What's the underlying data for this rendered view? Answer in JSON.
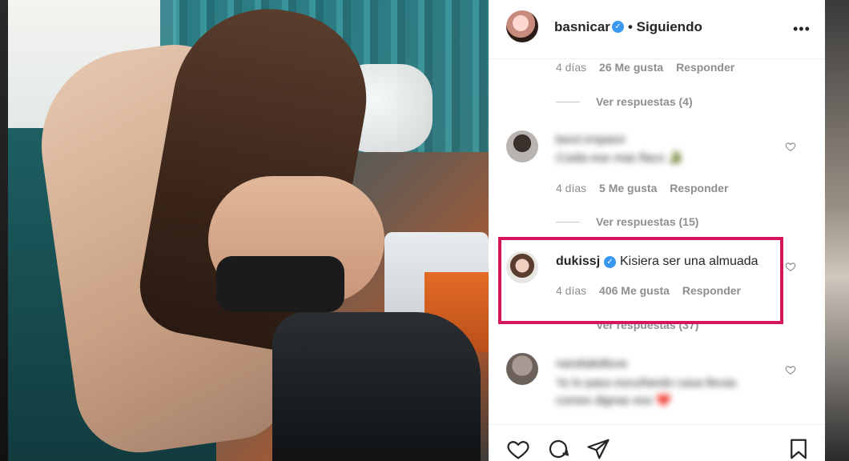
{
  "post": {
    "username": "basnicar",
    "follow_status": "• Siguiendo",
    "more_label": "•••"
  },
  "comments": [
    {
      "time": "4 días",
      "likes": "26 Me gusta",
      "reply": "Responder",
      "view_replies": "Ver respuestas (4)"
    },
    {
      "user_blurred": "bevri.irnpaon",
      "text_blurred": "Cuida ese mas flaco 🐊",
      "time": "4 días",
      "likes": "5 Me gusta",
      "reply": "Responder",
      "view_replies": "Ver respuestas (15)"
    },
    {
      "user": "dukissj",
      "text": "Kisiera ser una almuada",
      "time": "4 días",
      "likes": "406 Me gusta",
      "reply": "Responder",
      "view_replies": "Ver respuestas (37)"
    },
    {
      "user_blurred": "nandiabdlove",
      "text_blurred": "Yo lo paso escuñando casa llevas comes dignas eso ❤️"
    }
  ],
  "colors": {
    "highlight": "#d6155c",
    "verified": "#3897f0"
  }
}
